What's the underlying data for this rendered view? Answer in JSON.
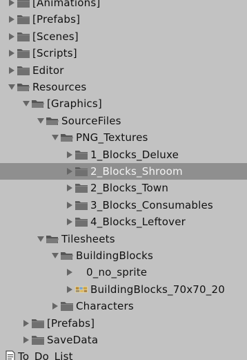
{
  "project_tree": {
    "items": [
      {
        "label": "[Animations]",
        "depth": 0,
        "expanded": false,
        "icon": "folder-icon"
      },
      {
        "label": "[Prefabs]",
        "depth": 0,
        "expanded": false,
        "icon": "folder-icon"
      },
      {
        "label": "[Scenes]",
        "depth": 0,
        "expanded": false,
        "icon": "folder-icon"
      },
      {
        "label": "[Scripts]",
        "depth": 0,
        "expanded": false,
        "icon": "folder-icon"
      },
      {
        "label": "Editor",
        "depth": 0,
        "expanded": false,
        "icon": "folder-icon"
      },
      {
        "label": "Resources",
        "depth": 0,
        "expanded": true,
        "icon": "open-folder-icon"
      },
      {
        "label": "[Graphics]",
        "depth": 1,
        "expanded": true,
        "icon": "open-folder-icon"
      },
      {
        "label": "SourceFiles",
        "depth": 2,
        "expanded": true,
        "icon": "open-folder-icon"
      },
      {
        "label": "PNG_Textures",
        "depth": 3,
        "expanded": true,
        "icon": "open-folder-icon"
      },
      {
        "label": "1_Blocks_Deluxe",
        "depth": 4,
        "expanded": false,
        "icon": "folder-icon"
      },
      {
        "label": "2_Blocks_Shroom",
        "depth": 4,
        "expanded": false,
        "icon": "folder-icon",
        "selected": true
      },
      {
        "label": "2_Blocks_Town",
        "depth": 4,
        "expanded": false,
        "icon": "folder-icon"
      },
      {
        "label": "3_Blocks_Consumables",
        "depth": 4,
        "expanded": false,
        "icon": "folder-icon"
      },
      {
        "label": "4_Blocks_Leftover",
        "depth": 4,
        "expanded": false,
        "icon": "folder-icon"
      },
      {
        "label": "Tilesheets",
        "depth": 2,
        "expanded": true,
        "icon": "open-folder-icon"
      },
      {
        "label": "BuildingBlocks",
        "depth": 3,
        "expanded": true,
        "icon": "open-folder-icon"
      },
      {
        "label": "0_no_sprite",
        "depth": 4,
        "expanded": false,
        "icon": "none"
      },
      {
        "label": "BuildingBlocks_70x70_20",
        "depth": 4,
        "expanded": false,
        "icon": "sprite-sheet-icon"
      },
      {
        "label": "Characters",
        "depth": 3,
        "expanded": false,
        "icon": "folder-icon"
      },
      {
        "label": "[Prefabs]",
        "depth": 1,
        "expanded": false,
        "icon": "folder-icon"
      },
      {
        "label": "SaveData",
        "depth": 1,
        "expanded": false,
        "icon": "folder-icon"
      },
      {
        "label": "To_Do_List",
        "depth": 0,
        "expanded": null,
        "icon": "text-file-icon"
      }
    ]
  },
  "colors": {
    "panel_background": "#c2c2c2",
    "selection_background": "#8f8f8f",
    "folder_fill": "#6e6e6e",
    "arrow": "#666666"
  }
}
